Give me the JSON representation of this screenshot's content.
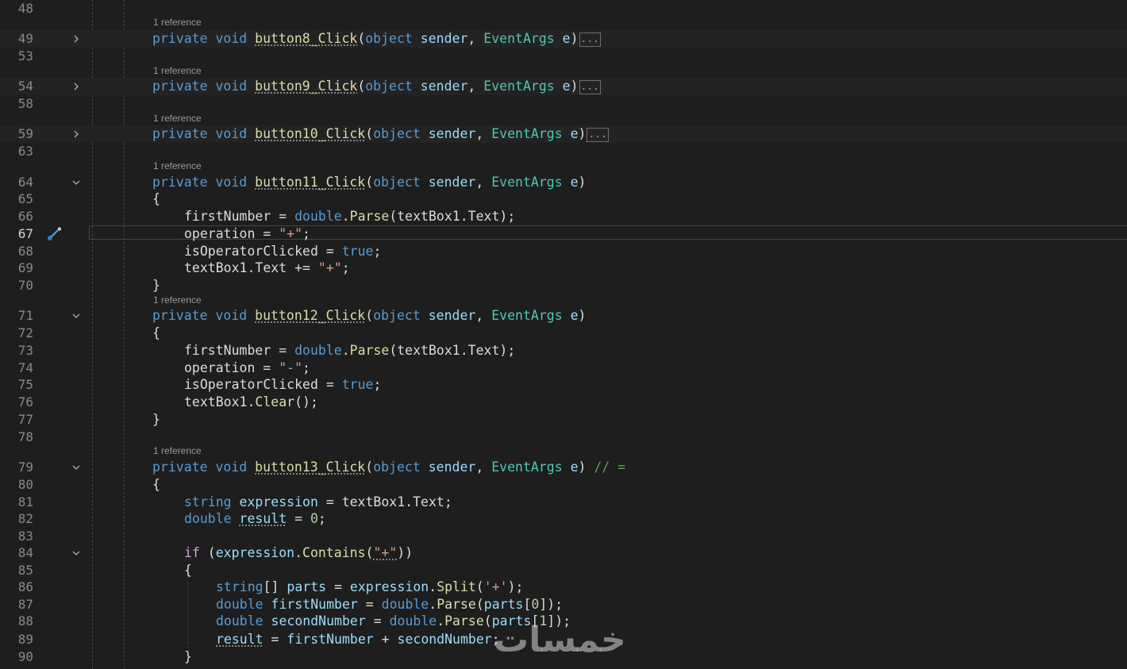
{
  "editor": {
    "codelens_label": "1 reference",
    "collapsed_marker": "...",
    "watermark": "خمسات",
    "current_line": "67"
  },
  "lines": [
    {
      "n": "48",
      "tokens": []
    },
    {
      "n": "49",
      "codelens": true,
      "fold": "collapsed",
      "collapsed": true,
      "tokens": [
        {
          "t": "private",
          "c": "kw"
        },
        {
          "t": " "
        },
        {
          "t": "void",
          "c": "kw"
        },
        {
          "t": " "
        },
        {
          "t": "button8_Click",
          "c": "fn",
          "d": true
        },
        {
          "t": "("
        },
        {
          "t": "object",
          "c": "kw"
        },
        {
          "t": " "
        },
        {
          "t": "sender",
          "c": "id"
        },
        {
          "t": ", "
        },
        {
          "t": "EventArgs",
          "c": "ty"
        },
        {
          "t": " "
        },
        {
          "t": "e",
          "c": "id"
        },
        {
          "t": ")"
        }
      ]
    },
    {
      "n": "53",
      "tokens": []
    },
    {
      "n": "54",
      "codelens": true,
      "fold": "collapsed",
      "collapsed": true,
      "tokens": [
        {
          "t": "private",
          "c": "kw"
        },
        {
          "t": " "
        },
        {
          "t": "void",
          "c": "kw"
        },
        {
          "t": " "
        },
        {
          "t": "button9_Click",
          "c": "fn",
          "d": true
        },
        {
          "t": "("
        },
        {
          "t": "object",
          "c": "kw"
        },
        {
          "t": " "
        },
        {
          "t": "sender",
          "c": "id"
        },
        {
          "t": ", "
        },
        {
          "t": "EventArgs",
          "c": "ty"
        },
        {
          "t": " "
        },
        {
          "t": "e",
          "c": "id"
        },
        {
          "t": ")"
        }
      ]
    },
    {
      "n": "58",
      "tokens": []
    },
    {
      "n": "59",
      "codelens": true,
      "fold": "collapsed",
      "collapsed": true,
      "tokens": [
        {
          "t": "private",
          "c": "kw"
        },
        {
          "t": " "
        },
        {
          "t": "void",
          "c": "kw"
        },
        {
          "t": " "
        },
        {
          "t": "button10_Click",
          "c": "fn",
          "d": true
        },
        {
          "t": "("
        },
        {
          "t": "object",
          "c": "kw"
        },
        {
          "t": " "
        },
        {
          "t": "sender",
          "c": "id"
        },
        {
          "t": ", "
        },
        {
          "t": "EventArgs",
          "c": "ty"
        },
        {
          "t": " "
        },
        {
          "t": "e",
          "c": "id"
        },
        {
          "t": ")"
        }
      ]
    },
    {
      "n": "63",
      "tokens": []
    },
    {
      "n": "64",
      "codelens": true,
      "fold": "expanded",
      "tokens": [
        {
          "t": "private",
          "c": "kw"
        },
        {
          "t": " "
        },
        {
          "t": "void",
          "c": "kw"
        },
        {
          "t": " "
        },
        {
          "t": "button11_Click",
          "c": "fn",
          "d": true
        },
        {
          "t": "("
        },
        {
          "t": "object",
          "c": "kw"
        },
        {
          "t": " "
        },
        {
          "t": "sender",
          "c": "id"
        },
        {
          "t": ", "
        },
        {
          "t": "EventArgs",
          "c": "ty"
        },
        {
          "t": " "
        },
        {
          "t": "e",
          "c": "id"
        },
        {
          "t": ")"
        }
      ]
    },
    {
      "n": "65",
      "tokens": [
        {
          "t": "{"
        }
      ]
    },
    {
      "n": "66",
      "indent": 1,
      "tokens": [
        {
          "t": "firstNumber",
          "c": "pl"
        },
        {
          "t": " = "
        },
        {
          "t": "double",
          "c": "kw"
        },
        {
          "t": "."
        },
        {
          "t": "Parse",
          "c": "fn"
        },
        {
          "t": "(textBox1.Text);"
        }
      ]
    },
    {
      "n": "67",
      "indent": 1,
      "tokens": [
        {
          "t": "operation",
          "c": "pl"
        },
        {
          "t": " = "
        },
        {
          "t": "\"+\"",
          "c": "st"
        },
        {
          "t": ";"
        }
      ]
    },
    {
      "n": "68",
      "indent": 1,
      "tokens": [
        {
          "t": "isOperatorClicked",
          "c": "pl"
        },
        {
          "t": " = "
        },
        {
          "t": "true",
          "c": "kw"
        },
        {
          "t": ";"
        }
      ]
    },
    {
      "n": "69",
      "indent": 1,
      "tokens": [
        {
          "t": "textBox1",
          "c": "pl"
        },
        {
          "t": "."
        },
        {
          "t": "Text",
          "c": "pl"
        },
        {
          "t": " += "
        },
        {
          "t": "\"+\"",
          "c": "st"
        },
        {
          "t": ";"
        }
      ]
    },
    {
      "n": "70",
      "tokens": [
        {
          "t": "}"
        }
      ]
    },
    {
      "n": "71",
      "codelens": true,
      "fold": "expanded",
      "tokens": [
        {
          "t": "private",
          "c": "kw"
        },
        {
          "t": " "
        },
        {
          "t": "void",
          "c": "kw"
        },
        {
          "t": " "
        },
        {
          "t": "button12_Click",
          "c": "fn",
          "d": true
        },
        {
          "t": "("
        },
        {
          "t": "object",
          "c": "kw"
        },
        {
          "t": " "
        },
        {
          "t": "sender",
          "c": "id"
        },
        {
          "t": ", "
        },
        {
          "t": "EventArgs",
          "c": "ty"
        },
        {
          "t": " "
        },
        {
          "t": "e",
          "c": "id"
        },
        {
          "t": ")"
        }
      ]
    },
    {
      "n": "72",
      "tokens": [
        {
          "t": "{"
        }
      ]
    },
    {
      "n": "73",
      "indent": 1,
      "tokens": [
        {
          "t": "firstNumber",
          "c": "pl"
        },
        {
          "t": " = "
        },
        {
          "t": "double",
          "c": "kw"
        },
        {
          "t": "."
        },
        {
          "t": "Parse",
          "c": "fn"
        },
        {
          "t": "(textBox1.Text);"
        }
      ]
    },
    {
      "n": "74",
      "indent": 1,
      "tokens": [
        {
          "t": "operation",
          "c": "pl"
        },
        {
          "t": " = "
        },
        {
          "t": "\"-\"",
          "c": "st"
        },
        {
          "t": ";"
        }
      ]
    },
    {
      "n": "75",
      "indent": 1,
      "tokens": [
        {
          "t": "isOperatorClicked",
          "c": "pl"
        },
        {
          "t": " = "
        },
        {
          "t": "true",
          "c": "kw"
        },
        {
          "t": ";"
        }
      ]
    },
    {
      "n": "76",
      "indent": 1,
      "tokens": [
        {
          "t": "textBox1",
          "c": "pl"
        },
        {
          "t": "."
        },
        {
          "t": "Clear",
          "c": "fn"
        },
        {
          "t": "();"
        }
      ]
    },
    {
      "n": "77",
      "tokens": [
        {
          "t": "}"
        }
      ]
    },
    {
      "n": "78",
      "tokens": []
    },
    {
      "n": "79",
      "codelens": true,
      "fold": "expanded",
      "tokens": [
        {
          "t": "private",
          "c": "kw"
        },
        {
          "t": " "
        },
        {
          "t": "void",
          "c": "kw"
        },
        {
          "t": " "
        },
        {
          "t": "button13_Click",
          "c": "fn",
          "d": true
        },
        {
          "t": "("
        },
        {
          "t": "object",
          "c": "kw"
        },
        {
          "t": " "
        },
        {
          "t": "sender",
          "c": "id"
        },
        {
          "t": ", "
        },
        {
          "t": "EventArgs",
          "c": "ty"
        },
        {
          "t": " "
        },
        {
          "t": "e",
          "c": "id"
        },
        {
          "t": ") "
        },
        {
          "t": "// =",
          "c": "cm"
        }
      ]
    },
    {
      "n": "80",
      "tokens": [
        {
          "t": "{"
        }
      ]
    },
    {
      "n": "81",
      "indent": 1,
      "tokens": [
        {
          "t": "string",
          "c": "kw"
        },
        {
          "t": " "
        },
        {
          "t": "expression",
          "c": "id"
        },
        {
          "t": " = textBox1.Text;"
        }
      ]
    },
    {
      "n": "82",
      "indent": 1,
      "tokens": [
        {
          "t": "double",
          "c": "kw"
        },
        {
          "t": " "
        },
        {
          "t": "result",
          "c": "id",
          "d": true
        },
        {
          "t": " = "
        },
        {
          "t": "0",
          "c": "nm"
        },
        {
          "t": ";"
        }
      ]
    },
    {
      "n": "83",
      "tokens": []
    },
    {
      "n": "84",
      "indent": 1,
      "fold": "expanded",
      "tokens": [
        {
          "t": "if",
          "c": "ct"
        },
        {
          "t": " ("
        },
        {
          "t": "expression",
          "c": "id"
        },
        {
          "t": "."
        },
        {
          "t": "Contains",
          "c": "fn"
        },
        {
          "t": "("
        },
        {
          "t": "\"+\"",
          "c": "st",
          "d": true
        },
        {
          "t": "))"
        }
      ]
    },
    {
      "n": "85",
      "indent": 1,
      "tokens": [
        {
          "t": "{"
        }
      ]
    },
    {
      "n": "86",
      "indent": 2,
      "tokens": [
        {
          "t": "string",
          "c": "kw"
        },
        {
          "t": "[] "
        },
        {
          "t": "parts",
          "c": "id"
        },
        {
          "t": " = "
        },
        {
          "t": "expression",
          "c": "id"
        },
        {
          "t": "."
        },
        {
          "t": "Split",
          "c": "fn"
        },
        {
          "t": "("
        },
        {
          "t": "'+'",
          "c": "st"
        },
        {
          "t": ");"
        }
      ]
    },
    {
      "n": "87",
      "indent": 2,
      "tokens": [
        {
          "t": "double",
          "c": "kw"
        },
        {
          "t": " "
        },
        {
          "t": "firstNumber",
          "c": "id"
        },
        {
          "t": " = "
        },
        {
          "t": "double",
          "c": "kw"
        },
        {
          "t": "."
        },
        {
          "t": "Parse",
          "c": "fn"
        },
        {
          "t": "("
        },
        {
          "t": "parts",
          "c": "id"
        },
        {
          "t": "["
        },
        {
          "t": "0",
          "c": "nm"
        },
        {
          "t": "]);"
        }
      ]
    },
    {
      "n": "88",
      "indent": 2,
      "tokens": [
        {
          "t": "double",
          "c": "kw"
        },
        {
          "t": " "
        },
        {
          "t": "secondNumber",
          "c": "id"
        },
        {
          "t": " = "
        },
        {
          "t": "double",
          "c": "kw"
        },
        {
          "t": "."
        },
        {
          "t": "Parse",
          "c": "fn"
        },
        {
          "t": "("
        },
        {
          "t": "parts",
          "c": "id"
        },
        {
          "t": "["
        },
        {
          "t": "1",
          "c": "nm"
        },
        {
          "t": "]);"
        }
      ]
    },
    {
      "n": "89",
      "indent": 2,
      "tokens": [
        {
          "t": "result",
          "c": "id",
          "d": true
        },
        {
          "t": " = "
        },
        {
          "t": "firstNumber",
          "c": "id"
        },
        {
          "t": " + "
        },
        {
          "t": "secondNumber",
          "c": "id"
        },
        {
          "t": ";"
        }
      ]
    },
    {
      "n": "90",
      "indent": 1,
      "tokens": [
        {
          "t": "}"
        }
      ]
    }
  ]
}
